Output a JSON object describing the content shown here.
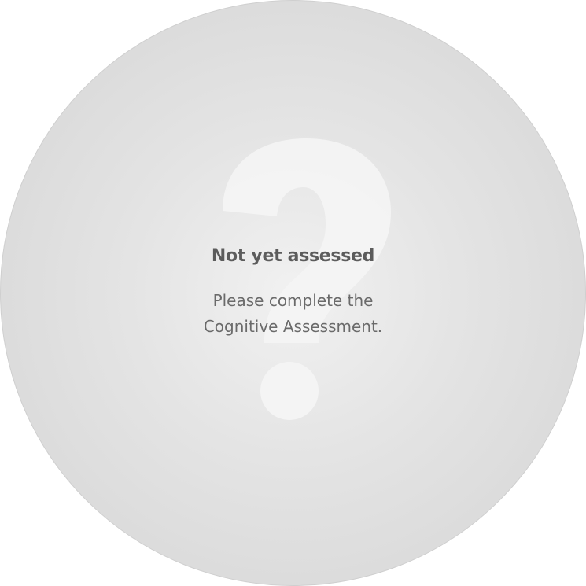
{
  "status": {
    "icon": "question-mark-icon",
    "title": "Not yet assessed",
    "message_line1": "Please complete the",
    "message_line2": "Cognitive Assessment."
  },
  "colors": {
    "circle_center": "#f1f1f1",
    "circle_edge": "#d4d4d4",
    "icon": "#f4f4f4",
    "text": "#5c5c5c"
  }
}
